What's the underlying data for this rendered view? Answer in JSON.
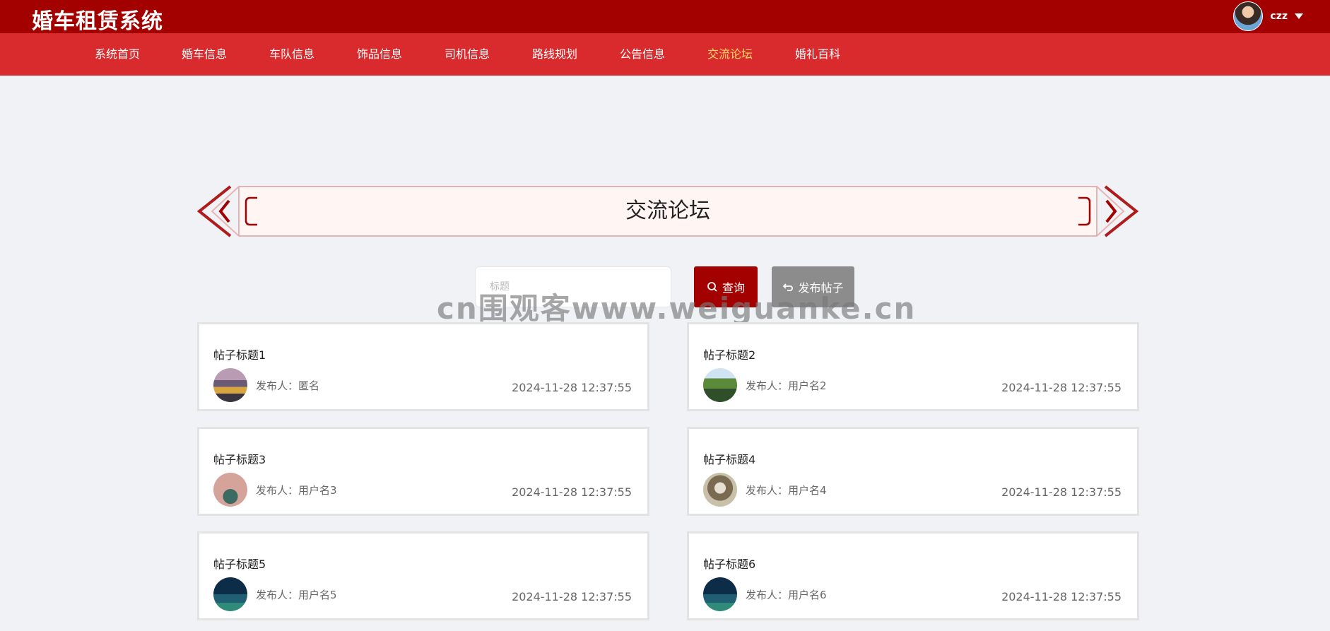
{
  "app": {
    "title": "婚车租赁系统"
  },
  "user": {
    "name": "czz"
  },
  "nav": {
    "items": [
      {
        "label": "系统首页"
      },
      {
        "label": "婚车信息"
      },
      {
        "label": "车队信息"
      },
      {
        "label": "饰品信息"
      },
      {
        "label": "司机信息"
      },
      {
        "label": "路线规划"
      },
      {
        "label": "公告信息"
      },
      {
        "label": "交流论坛",
        "active": true
      },
      {
        "label": "婚礼百科"
      }
    ]
  },
  "page": {
    "title": "交流论坛"
  },
  "search": {
    "placeholder": "标题",
    "query_button": "查询",
    "post_button": "发布帖子"
  },
  "watermark": "cn围观客www.weiguanke.cn",
  "colors": {
    "topbar": "#a30000",
    "navbar": "#d92b2e",
    "active_nav": "#ffd966",
    "query_button": "#a30000",
    "post_button": "#8c8c8c"
  },
  "posts": [
    {
      "title": "帖子标题1",
      "author": "发布人：匿名",
      "time": "2024-11-28 12:37:55"
    },
    {
      "title": "帖子标题2",
      "author": "发布人：用户名2",
      "time": "2024-11-28 12:37:55"
    },
    {
      "title": "帖子标题3",
      "author": "发布人：用户名3",
      "time": "2024-11-28 12:37:55"
    },
    {
      "title": "帖子标题4",
      "author": "发布人：用户名4",
      "time": "2024-11-28 12:37:55"
    },
    {
      "title": "帖子标题5",
      "author": "发布人：用户名5",
      "time": "2024-11-28 12:37:55"
    },
    {
      "title": "帖子标题6",
      "author": "发布人：用户名6",
      "time": "2024-11-28 12:37:55"
    }
  ]
}
